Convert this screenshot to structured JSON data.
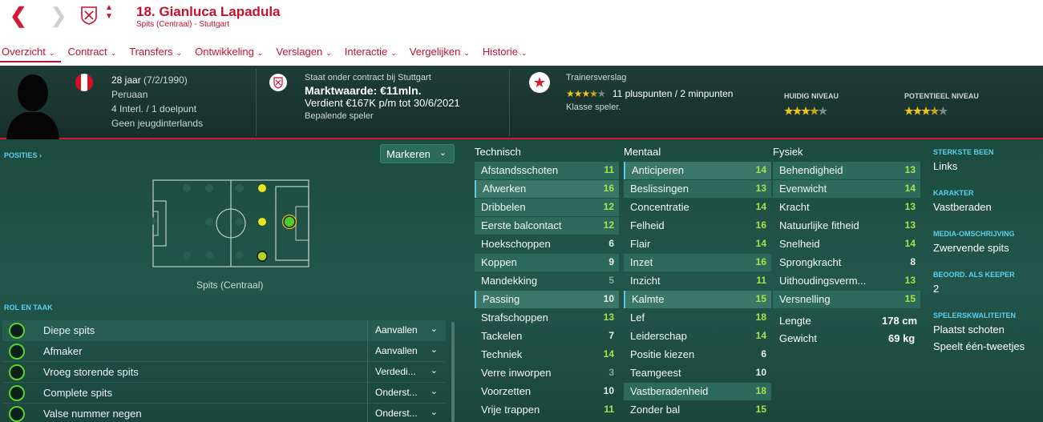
{
  "header": {
    "title": "18. Gianluca Lapadula",
    "subtitle": "Spits (Centraal) - Stuttgart"
  },
  "menu": [
    {
      "label": "Overzicht"
    },
    {
      "label": "Contract"
    },
    {
      "label": "Transfers"
    },
    {
      "label": "Ontwikkeling"
    },
    {
      "label": "Verslagen"
    },
    {
      "label": "Interactie"
    },
    {
      "label": "Vergelijken"
    },
    {
      "label": "Historie"
    }
  ],
  "info": {
    "age": "28 jaar",
    "dob": "(7/2/1990)",
    "nationality": "Peruaan",
    "caps": "4 Interl. / 1 doelpunt",
    "youth": "Geen jeugdinterlands",
    "contract_line": "Staat onder contract bij Stuttgart",
    "value": "Marktwaarde: €11mln.",
    "wage": "Verdient €167K p/m tot 30/6/2021",
    "status": "Bepalende speler",
    "report_label": "Trainersverslag",
    "report_summary": "11 pluspunten / 2 minpunten",
    "report_class": "Klasse speler.",
    "current_label": "HUIDIG NIVEAU",
    "potential_label": "POTENTIEEL NIVEAU",
    "rating_stars": 3.5,
    "current_stars": 3.5,
    "potential_stars": 3.5,
    "flag_colors": [
      "#d91023",
      "#ffffff",
      "#d91023"
    ]
  },
  "positions": {
    "label": "POSITIES",
    "dropdown": "Markeren",
    "caption": "Spits (Centraal)"
  },
  "roles": {
    "label": "ROL EN TAAK",
    "items": [
      {
        "name": "Diepe spits",
        "duty": "Aanvallen"
      },
      {
        "name": "Afmaker",
        "duty": "Aanvallen"
      },
      {
        "name": "Vroeg storende spits",
        "duty": "Verdedi..."
      },
      {
        "name": "Complete spits",
        "duty": "Onderst..."
      },
      {
        "name": "Valse nummer negen",
        "duty": "Onderst..."
      }
    ]
  },
  "technical": {
    "title": "Technisch",
    "attrs": [
      {
        "name": "Afstandsschoten",
        "value": "11"
      },
      {
        "name": "Afwerken",
        "value": "16"
      },
      {
        "name": "Dribbelen",
        "value": "12"
      },
      {
        "name": "Eerste balcontact",
        "value": "12"
      },
      {
        "name": "Hoekschoppen",
        "value": "6"
      },
      {
        "name": "Koppen",
        "value": "9"
      },
      {
        "name": "Mandekking",
        "value": "5"
      },
      {
        "name": "Passing",
        "value": "10"
      },
      {
        "name": "Strafschoppen",
        "value": "13"
      },
      {
        "name": "Tackelen",
        "value": "7"
      },
      {
        "name": "Techniek",
        "value": "14"
      },
      {
        "name": "Verre inworpen",
        "value": "3"
      },
      {
        "name": "Voorzetten",
        "value": "10"
      },
      {
        "name": "Vrije trappen",
        "value": "11"
      }
    ]
  },
  "mental": {
    "title": "Mentaal",
    "attrs": [
      {
        "name": "Anticiperen",
        "value": "14"
      },
      {
        "name": "Beslissingen",
        "value": "13"
      },
      {
        "name": "Concentratie",
        "value": "14"
      },
      {
        "name": "Felheid",
        "value": "16"
      },
      {
        "name": "Flair",
        "value": "14"
      },
      {
        "name": "Inzet",
        "value": "16"
      },
      {
        "name": "Inzicht",
        "value": "11"
      },
      {
        "name": "Kalmte",
        "value": "15"
      },
      {
        "name": "Lef",
        "value": "18"
      },
      {
        "name": "Leiderschap",
        "value": "14"
      },
      {
        "name": "Positie kiezen",
        "value": "6"
      },
      {
        "name": "Teamgeest",
        "value": "10"
      },
      {
        "name": "Vastberadenheid",
        "value": "18"
      },
      {
        "name": "Zonder bal",
        "value": "15"
      }
    ]
  },
  "physical": {
    "title": "Fysiek",
    "attrs": [
      {
        "name": "Behendigheid",
        "value": "13"
      },
      {
        "name": "Evenwicht",
        "value": "14"
      },
      {
        "name": "Kracht",
        "value": "13"
      },
      {
        "name": "Natuurlijke fitheid",
        "value": "13"
      },
      {
        "name": "Snelheid",
        "value": "14"
      },
      {
        "name": "Sprongkracht",
        "value": "8"
      },
      {
        "name": "Uithoudingsverm...",
        "value": "13"
      },
      {
        "name": "Versnelling",
        "value": "15"
      }
    ],
    "length_label": "Lengte",
    "length": "178 cm",
    "weight_label": "Gewicht",
    "weight": "69 kg"
  },
  "side": {
    "foot_label": "STERKSTE BEEN",
    "foot": "Links",
    "character_label": "KARAKTER",
    "character": "Vastberaden",
    "media_label": "MEDIA-OMSCHRIJVING",
    "media": "Zwervende spits",
    "keeper_label": "BEOORD. ALS KEEPER",
    "keeper": "2",
    "qualities_label": "SPELERSKWALITEITEN",
    "qualities": [
      "Plaatst schoten",
      "Speelt één-tweetjes"
    ]
  }
}
